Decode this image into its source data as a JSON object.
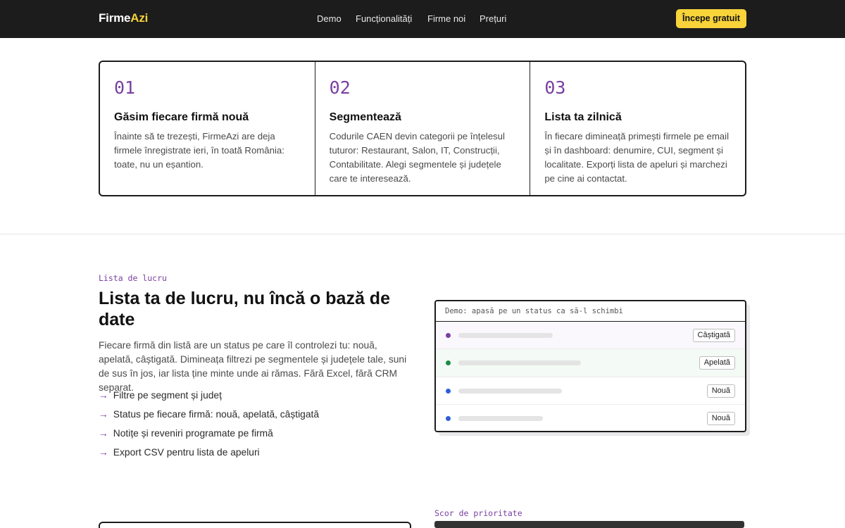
{
  "header": {
    "logo_main": "Firme",
    "logo_accent": "Azi",
    "nav": [
      "Demo",
      "Funcționalități",
      "Firme noi",
      "Prețuri"
    ],
    "cta": "Începe gratuit"
  },
  "steps": [
    {
      "num": "01",
      "title": "Găsim fiecare firmă nouă",
      "desc": "Înainte să te trezești, FirmeAzi are deja firmele înregistrate ieri, în toată România: toate, nu un eșantion."
    },
    {
      "num": "02",
      "title": "Segmentează",
      "desc": "Codurile CAEN devin categorii pe înțelesul tuturor: Restaurant, Salon, IT, Construcții, Contabilitate. Alegi segmentele și județele care te interesează."
    },
    {
      "num": "03",
      "title": "Lista ta zilnică",
      "desc": "În fiecare dimineață primești firmele pe email și în dashboard: denumire, CUI, segment și localitate. Exporți lista de apeluri și marchezi pe cine ai contactat."
    }
  ],
  "worklist": {
    "eyebrow": "Lista de lucru",
    "title": "Lista ta de lucru, nu încă o bază de date",
    "lead": "Fiecare firmă din listă are un status pe care îl controlezi tu: nouă, apelată, câștigată. Dimineața filtrezi pe segmentele și județele tale, suni de sus în jos, iar lista ține minte unde ai rămas. Fără Excel, fără CRM separat.",
    "features": [
      "Filtre pe segment și județ",
      "Status pe fiecare firmă: nouă, apelată, câștigată",
      "Notițe și reveniri programate pe firmă",
      "Export CSV pentru lista de apeluri"
    ],
    "arrow": "→"
  },
  "demo": {
    "header": "Demo: apasă pe un status ca să-l schimbi",
    "rows": [
      {
        "status": "Câștigată",
        "dot_color": "#7a3fa0",
        "row_bg": "#fbf8fd"
      },
      {
        "status": "Apelată",
        "dot_color": "#1e8a4a",
        "row_bg": "#f4faf5"
      },
      {
        "status": "Nouă",
        "dot_color": "#2d5fd8",
        "row_bg": "#ffffff"
      },
      {
        "status": "Nouă",
        "dot_color": "#2d5fd8",
        "row_bg": "#ffffff"
      }
    ]
  },
  "priority": {
    "eyebrow": "Scor de prioritate"
  },
  "colors": {
    "accent": "#f8d33a",
    "purple": "#7a3fa0",
    "dark": "#1c1c1c"
  }
}
